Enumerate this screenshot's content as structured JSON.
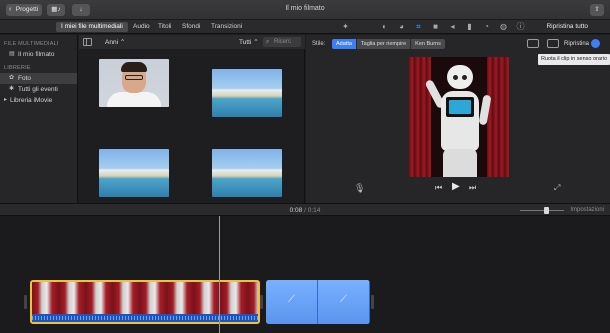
{
  "window": {
    "title": "Il mio filmato"
  },
  "toolbar": {
    "projects_label": "Progetti",
    "reset_all_label": "Ripristina tutto",
    "adjust_icons": [
      "magic-wand-icon",
      "color-balance-icon",
      "color-correction-icon",
      "crop-icon",
      "stabilization-icon",
      "volume-icon",
      "noise-reduction-icon",
      "speed-icon",
      "filter-icon",
      "info-icon"
    ],
    "active_adjust_icon": "crop-icon"
  },
  "tabs": [
    {
      "label": "I miei file multimediali",
      "active": true
    },
    {
      "label": "Audio",
      "active": false
    },
    {
      "label": "Titoli",
      "active": false
    },
    {
      "label": "Sfondi",
      "active": false
    },
    {
      "label": "Transizioni",
      "active": false
    }
  ],
  "sidebar": {
    "section1": "FILE MULTIMEDIALI",
    "project_item": "Il mio filmato",
    "section2": "LIBRERIE",
    "items": [
      {
        "label": "Foto",
        "selected": true
      },
      {
        "label": "Tutti gli eventi",
        "selected": false
      },
      {
        "label": "Libreria iMovie",
        "selected": false
      }
    ]
  },
  "browser": {
    "group_by": "Anni",
    "filter": "Tutti",
    "search_placeholder": "Ricerc",
    "thumbnails": [
      "portrait",
      "beach",
      "beach",
      "beach"
    ]
  },
  "viewer": {
    "style_label": "Stile:",
    "styles": [
      "Adatta",
      "Taglia per riempire",
      "Ken Burns"
    ],
    "active_style": "Adatta",
    "reset_label": "Ripristina",
    "tooltip": "Ruota il clip in senso orario"
  },
  "timebar": {
    "current_time": "0:08",
    "separator": "/",
    "total_time": "0:14",
    "settings_label": "Impostazioni",
    "zoom_level": 0.55
  },
  "timeline": {
    "clips": [
      {
        "kind": "video",
        "selected": true,
        "has_audio": true
      },
      {
        "kind": "photo",
        "selected": false,
        "has_audio": false
      }
    ]
  },
  "colors": {
    "accent": "#3d7ff5",
    "selection_border": "#f2c13a",
    "background": "#1d1d1f"
  }
}
